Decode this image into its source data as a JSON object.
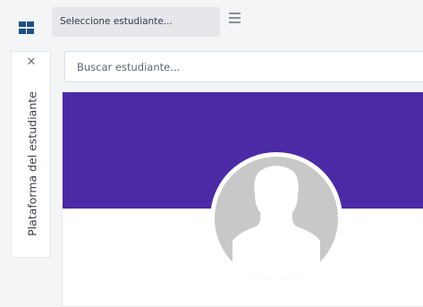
{
  "header": {
    "app_icon": "grid-icon",
    "student_tab": {
      "label": "Seleccione estudiante..."
    },
    "menu_icon": "hamburger-icon"
  },
  "side_panel": {
    "close_icon": "close-icon",
    "title": "Plataforma del estudiante"
  },
  "search": {
    "placeholder": "Buscar estudiante..."
  },
  "profile": {
    "banner_color": "#4b2aa6",
    "avatar_icon": "user-silhouette-icon"
  }
}
